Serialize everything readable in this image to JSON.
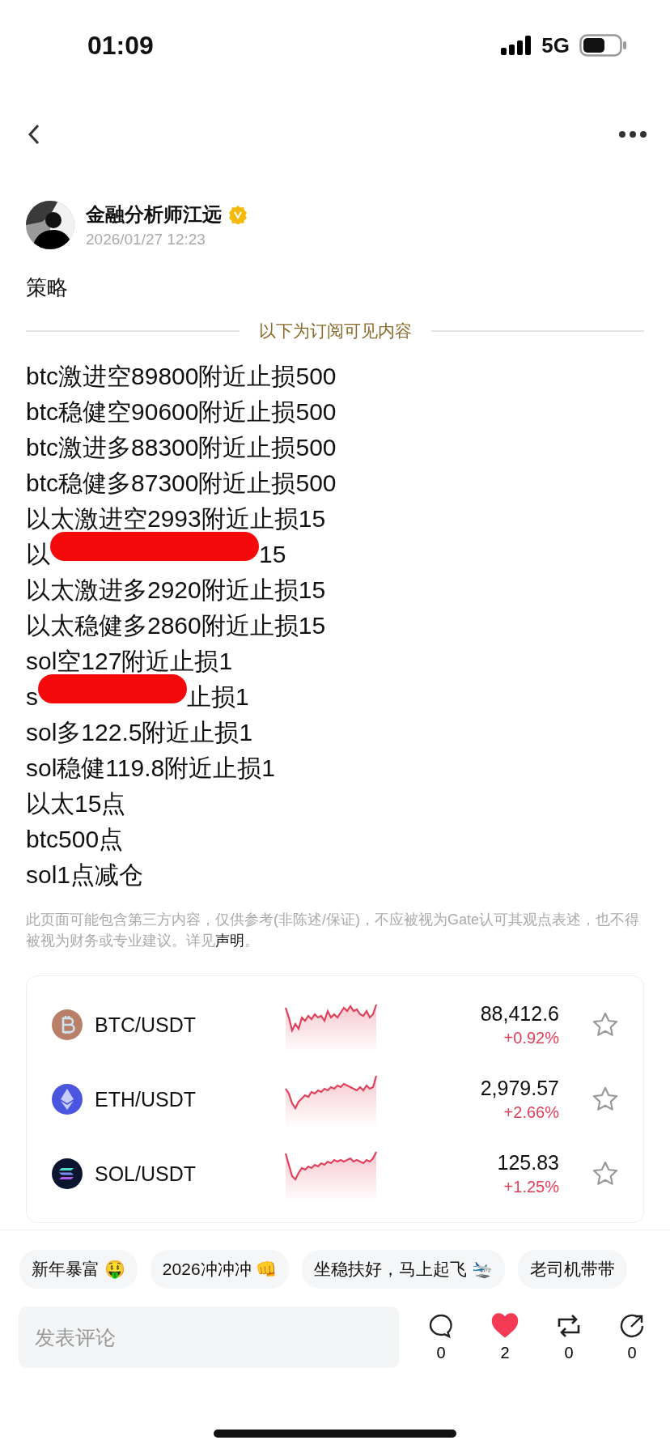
{
  "status_bar": {
    "time": "01:09",
    "network": "5G"
  },
  "post": {
    "author": "金融分析师江远",
    "verified": true,
    "time": "2026/01/27 12:23",
    "title": "策略",
    "divider_label": "以下为订阅可见内容",
    "lines": [
      {
        "kind": "text",
        "text": "btc激进空89800附近止损500"
      },
      {
        "kind": "text",
        "text": "btc稳健空90600附近止损500"
      },
      {
        "kind": "text",
        "text": "btc激进多88300附近止损500"
      },
      {
        "kind": "text",
        "text": "btc稳健多87300附近止损500"
      },
      {
        "kind": "text",
        "text": "以太激进空2993附近止损15"
      },
      {
        "kind": "redacted",
        "start": "以",
        "end": "15"
      },
      {
        "kind": "text",
        "text": "以太激进多2920附近止损15"
      },
      {
        "kind": "text",
        "text": "以太稳健多2860附近止损15"
      },
      {
        "kind": "text",
        "text": "sol空127附近止损1"
      },
      {
        "kind": "redacted",
        "start": "s",
        "end": "止损1"
      },
      {
        "kind": "text",
        "text": "sol多122.5附近止损1"
      },
      {
        "kind": "text",
        "text": "sol稳健119.8附近止损1"
      },
      {
        "kind": "text",
        "text": "以太15点"
      },
      {
        "kind": "text",
        "text": "btc500点"
      },
      {
        "kind": "text",
        "text": "sol1点减仓"
      }
    ],
    "disclaimer": "此页面可能包含第三方内容，仅供参考(非陈述/保证)，不应被视为Gate认可其观点表述，也不得被视为财务或专业建议。详见",
    "disclaimer_link": "声明",
    "disclaimer_end": "。"
  },
  "markets": [
    {
      "kind": "btc",
      "pair": "BTC/USDT",
      "price": "88,412.6",
      "change": "+0.92%",
      "starred": false
    },
    {
      "kind": "eth",
      "pair": "ETH/USDT",
      "price": "2,979.57",
      "change": "+2.66%",
      "starred": false
    },
    {
      "kind": "sol",
      "pair": "SOL/USDT",
      "price": "125.83",
      "change": "+1.25%",
      "starred": false
    }
  ],
  "tags": [
    "新年暴富 🤑",
    "2026冲冲冲 👊",
    "坐稳扶好，马上起飞 🛬",
    "老司机带带"
  ],
  "comment": {
    "placeholder": "发表评论"
  },
  "actions": [
    {
      "kind": "comment",
      "count": "0",
      "active": false
    },
    {
      "kind": "like",
      "count": "2",
      "active": true
    },
    {
      "kind": "repost",
      "count": "0",
      "active": false
    },
    {
      "kind": "share",
      "count": "0",
      "active": false
    }
  ]
}
